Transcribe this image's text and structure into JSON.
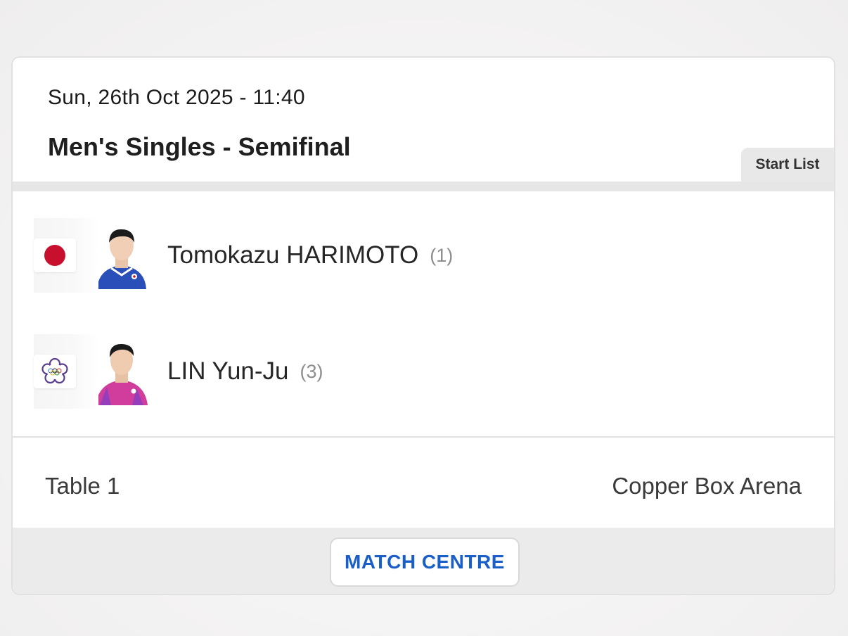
{
  "match": {
    "datetime": "Sun, 26th Oct 2025 - 11:40",
    "event": "Men's Singles - Semifinal",
    "start_list_label": "Start List"
  },
  "players": [
    {
      "name": "Tomokazu HARIMOTO",
      "seed": "(1)",
      "flag_icon": "japan-flag-icon",
      "flag_colors": {
        "field": "#ffffff",
        "disc": "#c8102e"
      },
      "jersey_color": "#2b4fb8"
    },
    {
      "name": "LIN Yun-Ju",
      "seed": "(3)",
      "flag_icon": "chinese-taipei-olympic-flag-icon",
      "flag_colors": {
        "field": "#ffffff",
        "flower": "#5a3f8e"
      },
      "jersey_color": "#d13d9c"
    }
  ],
  "details": {
    "table": "Table 1",
    "venue": "Copper Box Arena"
  },
  "actions": {
    "match_centre_label": "MATCH CENTRE"
  },
  "colors": {
    "accent": "#1a5fc8",
    "card_border": "#e2e1e1",
    "band": "#e7e6e6"
  }
}
